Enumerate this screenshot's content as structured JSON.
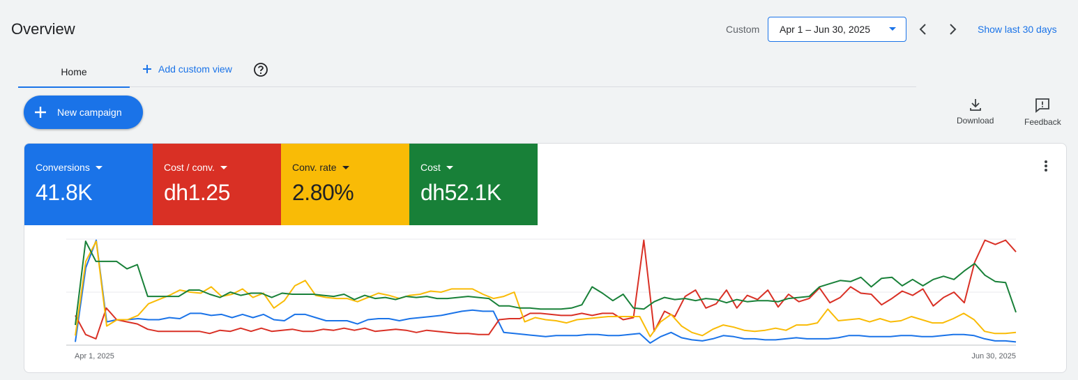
{
  "header": {
    "title": "Overview",
    "custom_label": "Custom",
    "date_range": "Apr 1 – Jun 30, 2025",
    "show_last": "Show last 30 days"
  },
  "tabs": {
    "home": "Home",
    "add_custom_view": "Add custom view"
  },
  "actions": {
    "new_campaign": "New campaign",
    "download": "Download",
    "feedback": "Feedback"
  },
  "metrics": [
    {
      "label": "Conversions",
      "value": "41.8K",
      "color": "#1a73e8"
    },
    {
      "label": "Cost / conv.",
      "value": "dh1.25",
      "color": "#d93025"
    },
    {
      "label": "Conv. rate",
      "value": "2.80%",
      "color": "#f9bb06"
    },
    {
      "label": "Cost",
      "value": "dh52.1K",
      "color": "#188038"
    }
  ],
  "chart_data": {
    "type": "line",
    "x_start_label": "Apr 1, 2025",
    "x_end_label": "Jun 30, 2025",
    "grid": true,
    "ylim": [
      0,
      100
    ],
    "series": [
      {
        "name": "Conversions",
        "color": "#1a73e8",
        "values": [
          3,
          73,
          99,
          22,
          24,
          24,
          25,
          24,
          24,
          26,
          25,
          30,
          30,
          28,
          29,
          26,
          29,
          26,
          29,
          24,
          23,
          29,
          29,
          26,
          23,
          23,
          23,
          20,
          24,
          25,
          25,
          23,
          25,
          26,
          27,
          28,
          30,
          32,
          33,
          32,
          32,
          12,
          11,
          10,
          9,
          8,
          9,
          9,
          9,
          10,
          10,
          9,
          9,
          10,
          11,
          2,
          8,
          12,
          7,
          5,
          4,
          6,
          9,
          8,
          6,
          6,
          5,
          5,
          6,
          7,
          6,
          6,
          6,
          7,
          9,
          9,
          8,
          8,
          8,
          9,
          9,
          8,
          8,
          9,
          10,
          10,
          9,
          6,
          4,
          4,
          3
        ]
      },
      {
        "name": "Cost / conv.",
        "color": "#d93025",
        "values": [
          28,
          10,
          6,
          35,
          24,
          22,
          20,
          15,
          13,
          13,
          13,
          13,
          13,
          11,
          14,
          13,
          16,
          13,
          16,
          13,
          14,
          15,
          13,
          13,
          15,
          14,
          16,
          14,
          16,
          13,
          14,
          15,
          14,
          12,
          14,
          13,
          12,
          11,
          11,
          10,
          10,
          24,
          25,
          25,
          30,
          30,
          29,
          28,
          28,
          30,
          28,
          30,
          30,
          24,
          26,
          99,
          13,
          32,
          27,
          46,
          52,
          35,
          39,
          52,
          35,
          47,
          43,
          52,
          36,
          48,
          41,
          44,
          54,
          40,
          45,
          55,
          49,
          48,
          38,
          44,
          51,
          47,
          53,
          37,
          45,
          50,
          40,
          78,
          99,
          95,
          99,
          88
        ]
      },
      {
        "name": "Conv. rate",
        "color": "#f9bb06",
        "values": [
          9,
          79,
          98,
          18,
          24,
          24,
          28,
          39,
          43,
          47,
          52,
          50,
          49,
          55,
          46,
          48,
          53,
          45,
          49,
          35,
          42,
          56,
          61,
          47,
          45,
          44,
          44,
          41,
          45,
          49,
          47,
          44,
          47,
          48,
          51,
          50,
          53,
          53,
          53,
          48,
          44,
          46,
          50,
          22,
          26,
          24,
          23,
          21,
          24,
          25,
          26,
          27,
          27,
          27,
          27,
          8,
          22,
          29,
          18,
          12,
          9,
          15,
          19,
          17,
          14,
          13,
          14,
          16,
          14,
          19,
          19,
          21,
          34,
          23,
          24,
          25,
          22,
          25,
          22,
          23,
          27,
          24,
          21,
          21,
          25,
          30,
          24,
          13,
          11,
          11,
          12
        ]
      },
      {
        "name": "Cost",
        "color": "#188038",
        "values": [
          19,
          98,
          79,
          79,
          79,
          72,
          76,
          46,
          46,
          46,
          46,
          52,
          52,
          48,
          45,
          50,
          47,
          49,
          49,
          45,
          49,
          48,
          48,
          48,
          47,
          46,
          48,
          43,
          47,
          44,
          45,
          43,
          46,
          45,
          46,
          44,
          44,
          45,
          46,
          45,
          44,
          37,
          37,
          35,
          35,
          34,
          34,
          34,
          35,
          38,
          55,
          49,
          42,
          48,
          35,
          34,
          41,
          45,
          43,
          44,
          42,
          44,
          43,
          40,
          43,
          41,
          42,
          42,
          41,
          44,
          45,
          46,
          55,
          58,
          61,
          60,
          64,
          55,
          63,
          64,
          56,
          62,
          56,
          62,
          65,
          62,
          70,
          77,
          66,
          60,
          59,
          31
        ]
      }
    ]
  }
}
